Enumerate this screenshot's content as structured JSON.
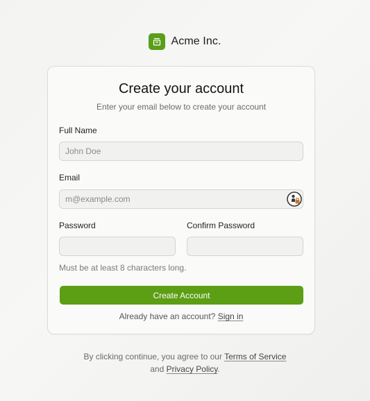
{
  "brand": {
    "name": "Acme Inc.",
    "logo_icon": "box-icon",
    "accent_color": "#5a9e1a"
  },
  "card": {
    "title": "Create your account",
    "subtitle": "Enter your email below to create your account"
  },
  "form": {
    "full_name": {
      "label": "Full Name",
      "placeholder": "John Doe",
      "value": ""
    },
    "email": {
      "label": "Email",
      "placeholder": "m@example.com",
      "value": "",
      "autofill_icon": "password-manager-icon"
    },
    "password": {
      "label": "Password",
      "placeholder": "",
      "value": ""
    },
    "confirm_password": {
      "label": "Confirm Password",
      "placeholder": "",
      "value": ""
    },
    "password_hint": "Must be at least 8 characters long.",
    "submit_label": "Create Account"
  },
  "signin": {
    "prompt": "Already have an account?",
    "link_label": "Sign in"
  },
  "legal": {
    "prefix": "By clicking continue, you agree to our",
    "terms_label": "Terms of Service",
    "and_text": "and",
    "privacy_label": "Privacy Policy",
    "suffix": "."
  }
}
